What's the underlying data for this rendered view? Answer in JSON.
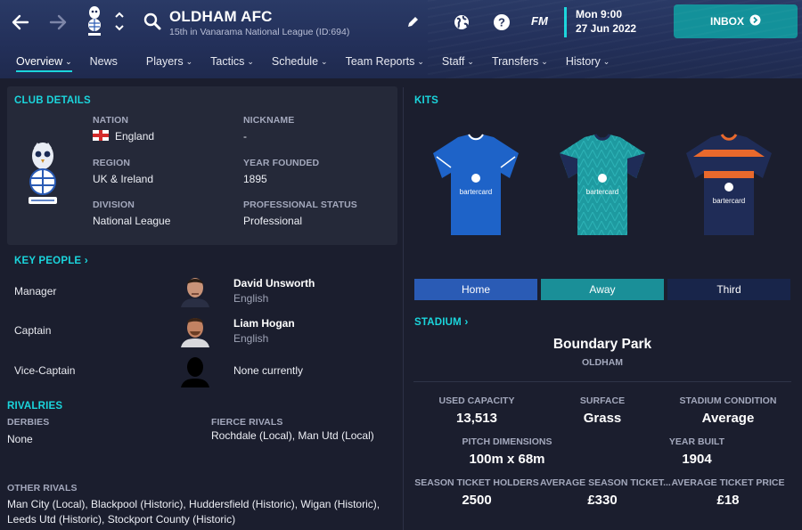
{
  "header": {
    "club_name": "OLDHAM AFC",
    "subtitle": "15th in Vanarama National League (ID:694)",
    "fm_label": "FM",
    "date_line1": "Mon 9:00",
    "date_line2": "27 Jun 2022",
    "inbox_label": "INBOX",
    "accent_color": "#1bd5dc",
    "inbox_color": "#13919a"
  },
  "tabs": [
    {
      "label": "Overview",
      "dropdown": true
    },
    {
      "label": "News",
      "dropdown": false
    },
    {
      "label": "Players",
      "dropdown": true
    },
    {
      "label": "Tactics",
      "dropdown": true
    },
    {
      "label": "Schedule",
      "dropdown": true
    },
    {
      "label": "Team Reports",
      "dropdown": true
    },
    {
      "label": "Staff",
      "dropdown": true
    },
    {
      "label": "Transfers",
      "dropdown": true
    },
    {
      "label": "History",
      "dropdown": true
    }
  ],
  "club_details": {
    "heading": "CLUB DETAILS",
    "nation_label": "NATION",
    "nation_value": "England",
    "nickname_label": "NICKNAME",
    "nickname_value": "-",
    "region_label": "REGION",
    "region_value": "UK & Ireland",
    "year_founded_label": "YEAR FOUNDED",
    "year_founded_value": "1895",
    "division_label": "DIVISION",
    "division_value": "National League",
    "status_label": "PROFESSIONAL STATUS",
    "status_value": "Professional"
  },
  "key_people": {
    "heading": "KEY PEOPLE",
    "people": [
      {
        "role": "Manager",
        "name": "David Unsworth",
        "nationality": "English"
      },
      {
        "role": "Captain",
        "name": "Liam Hogan",
        "nationality": "English"
      },
      {
        "role": "Vice-Captain",
        "name": "None currently",
        "nationality": ""
      }
    ]
  },
  "rivalries": {
    "heading": "RIVALRIES",
    "derbies_label": "DERBIES",
    "derbies_value": "None",
    "fierce_label": "FIERCE RIVALS",
    "fierce_value": "Rochdale (Local), Man Utd (Local)",
    "other_label": "OTHER RIVALS",
    "other_line1": "Man City (Local), Blackpool (Historic), Huddersfield (Historic), Wigan (Historic),",
    "other_line2": "Leeds Utd (Historic), Stockport County (Historic)"
  },
  "kits": {
    "heading": "KITS",
    "sponsor": "bartercard",
    "buttons": [
      {
        "label": "Home",
        "color": "#2a5bb5"
      },
      {
        "label": "Away",
        "color": "#1a8f98"
      },
      {
        "label": "Third",
        "color": "#18254a"
      }
    ],
    "home_color": "#1e63c8",
    "away_color": "#1e9aa0",
    "third_color": "#1f2c57"
  },
  "stadium": {
    "heading": "STADIUM",
    "name": "Boundary Park",
    "city": "OLDHAM",
    "used_capacity_label": "USED CAPACITY",
    "used_capacity_value": "13,513",
    "surface_label": "SURFACE",
    "surface_value": "Grass",
    "condition_label": "STADIUM CONDITION",
    "condition_value": "Average",
    "pitch_label": "PITCH DIMENSIONS",
    "pitch_value": "100m x 68m",
    "year_built_label": "YEAR BUILT",
    "year_built_value": "1904",
    "season_ticket_label": "SEASON TICKET HOLDERS",
    "season_ticket_value": "2500",
    "avg_season_label": "AVERAGE SEASON TICKET...",
    "avg_season_value": "£330",
    "avg_ticket_label": "AVERAGE TICKET PRICE",
    "avg_ticket_value": "£18"
  }
}
